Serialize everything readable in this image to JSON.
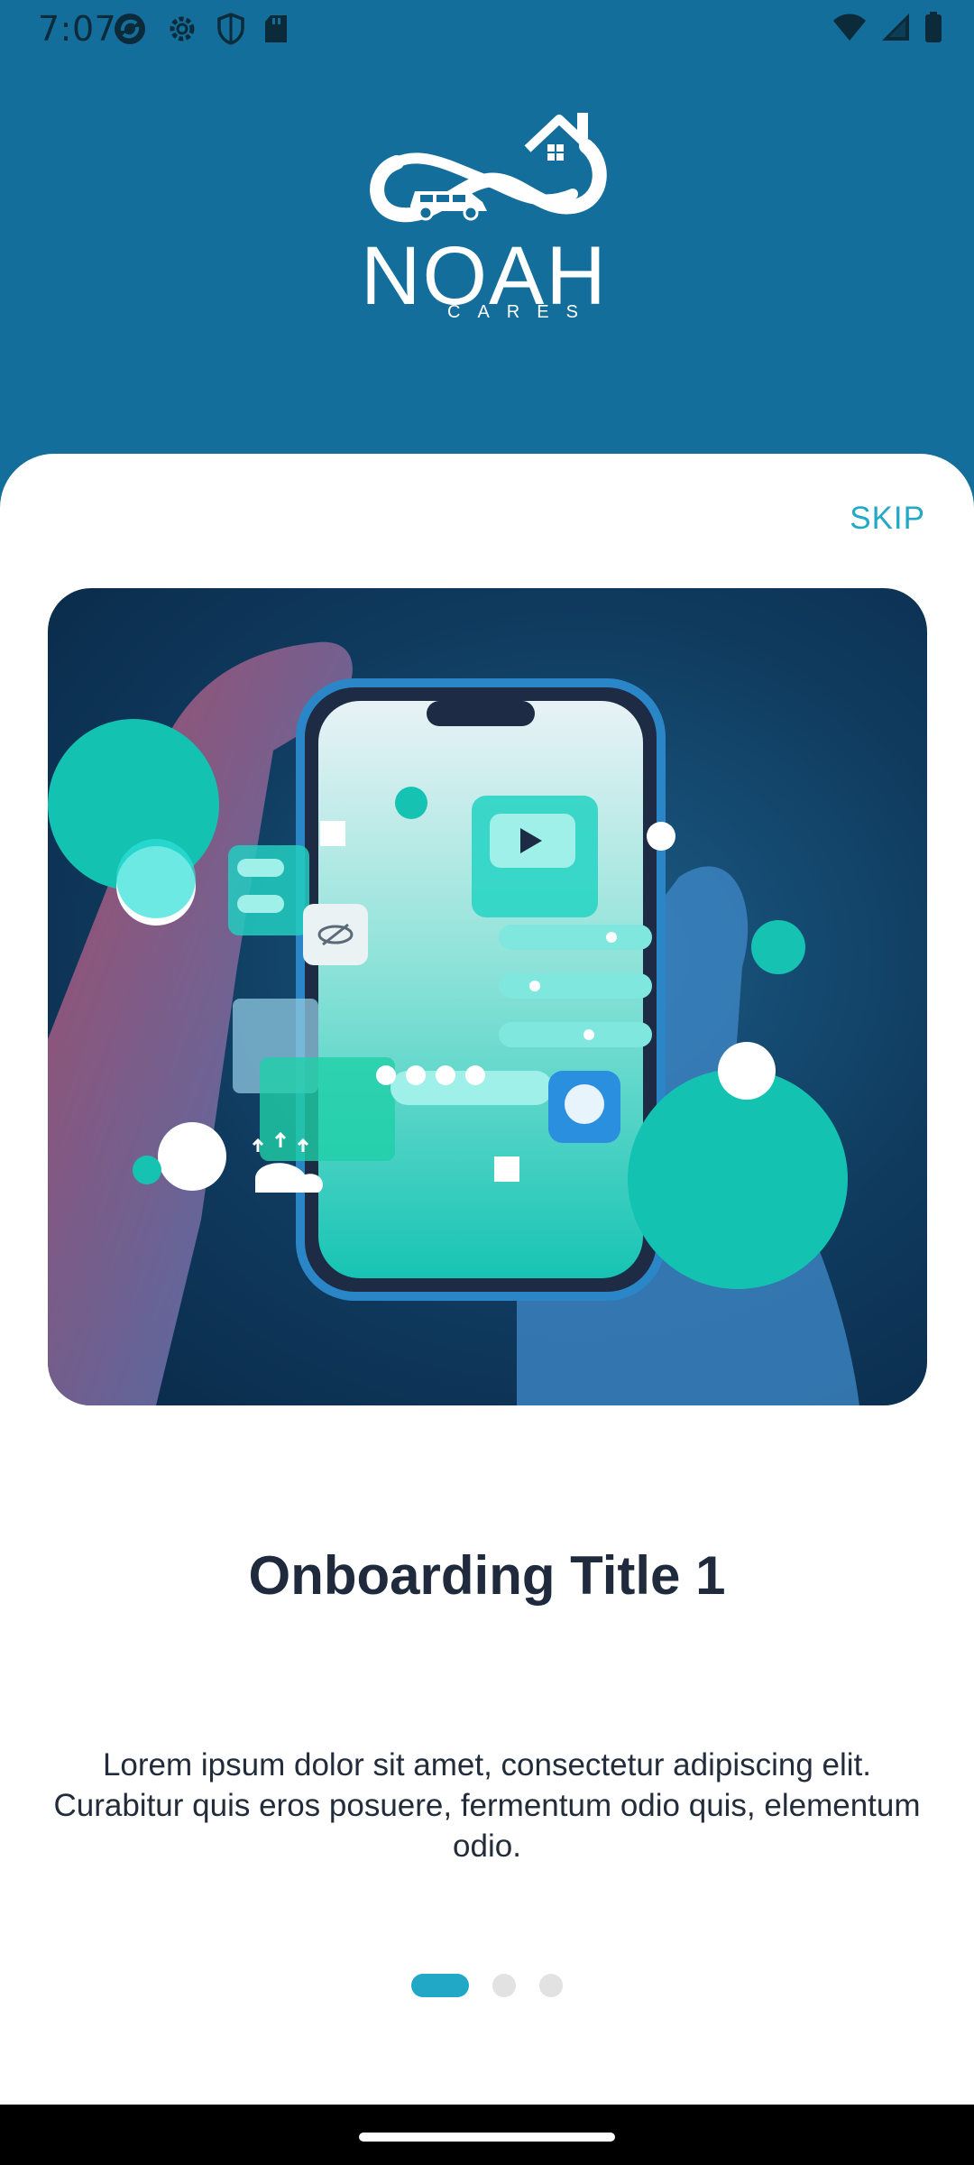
{
  "status_bar": {
    "time": "7:07",
    "left_icons": [
      "sync-icon",
      "gear-icon",
      "shield-icon",
      "sd-card-icon"
    ],
    "right_icons": [
      "wifi-icon",
      "signal-icon",
      "battery-icon"
    ]
  },
  "brand": {
    "name": "NOAH",
    "tagline": "CARES"
  },
  "onboarding": {
    "skip_label": "SKIP",
    "title": "Onboarding Title 1",
    "description": "Lorem ipsum dolor sit amet, consectetur adipiscing elit. Curabitur quis eros posuere, fermentum odio quis, elementum odio.",
    "current_page": 1,
    "total_pages": 3
  },
  "colors": {
    "header_bg": "#146e9b",
    "accent": "#21a8c6",
    "title_text": "#1f2a3d",
    "inactive_dot": "#e2e2e2"
  }
}
